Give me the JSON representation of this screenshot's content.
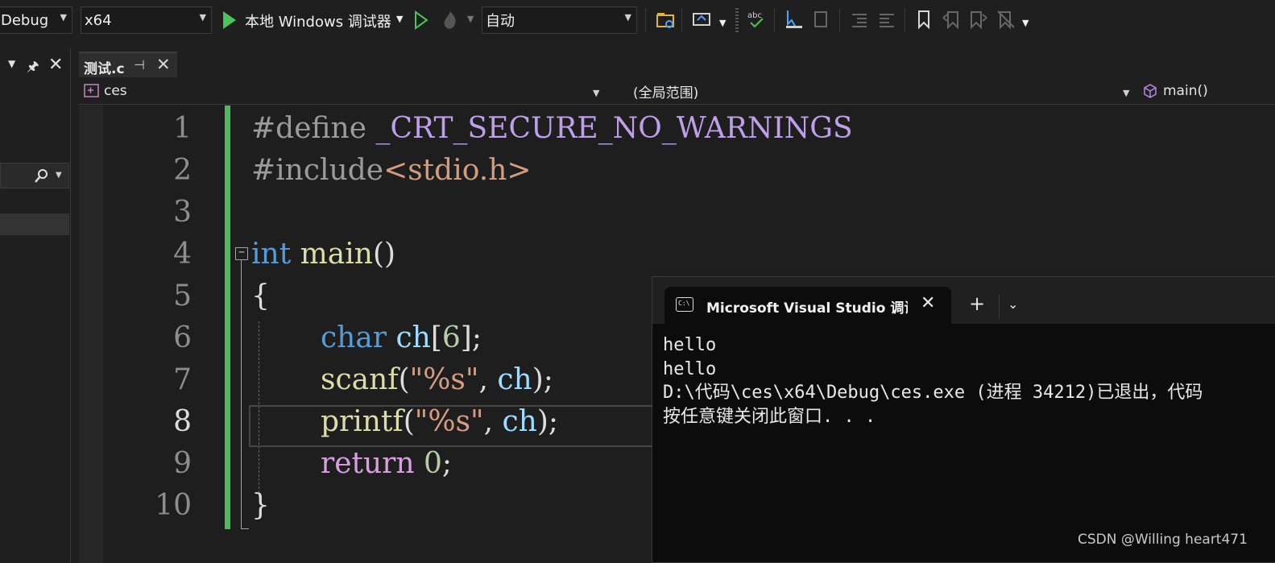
{
  "toolbar": {
    "config_value": "Debug",
    "platform_value": "x64",
    "run_label": "本地 Windows 调试器",
    "auto_value": "自动"
  },
  "tab": {
    "title": "测试.c"
  },
  "navbar": {
    "project": "ces",
    "scope": "(全局范围)",
    "member": "main()"
  },
  "editor": {
    "line_numbers": [
      "1",
      "2",
      "3",
      "4",
      "5",
      "6",
      "7",
      "8",
      "9",
      "10"
    ],
    "current_line": "8",
    "lines": {
      "l1_directive": "#define",
      "l1_macro": "_CRT_SECURE_NO_WARNINGS",
      "l2_directive": "#include",
      "l2_header": "<stdio.h>",
      "l4_type": "int",
      "l4_func": "main",
      "l4_parens": "()",
      "l5_brace": "{",
      "l6_type": "char",
      "l6_var": "ch",
      "l6_rest1": "[",
      "l6_num": "6",
      "l6_rest2": "];",
      "l7_func": "scanf",
      "l7_open": "(",
      "l7_str": "\"%s\"",
      "l7_comma": ", ",
      "l7_var": "ch",
      "l7_close": ");",
      "l8_func": "printf",
      "l8_open": "(",
      "l8_str": "\"%s\"",
      "l8_comma": ", ",
      "l8_var": "ch",
      "l8_close": ");",
      "l9_kw": "return",
      "l9_num": "0",
      "l9_semi": ";",
      "l10_brace": "}"
    }
  },
  "terminal": {
    "tab_title": "Microsoft Visual Studio 调试控制台",
    "icon_text": "C:\\",
    "output": [
      "hello",
      "hello",
      "D:\\代码\\ces\\x64\\Debug\\ces.exe (进程 34212)已退出，代码",
      "按任意键关闭此窗口. . ."
    ]
  },
  "watermark": "CSDN @Willing heart471"
}
